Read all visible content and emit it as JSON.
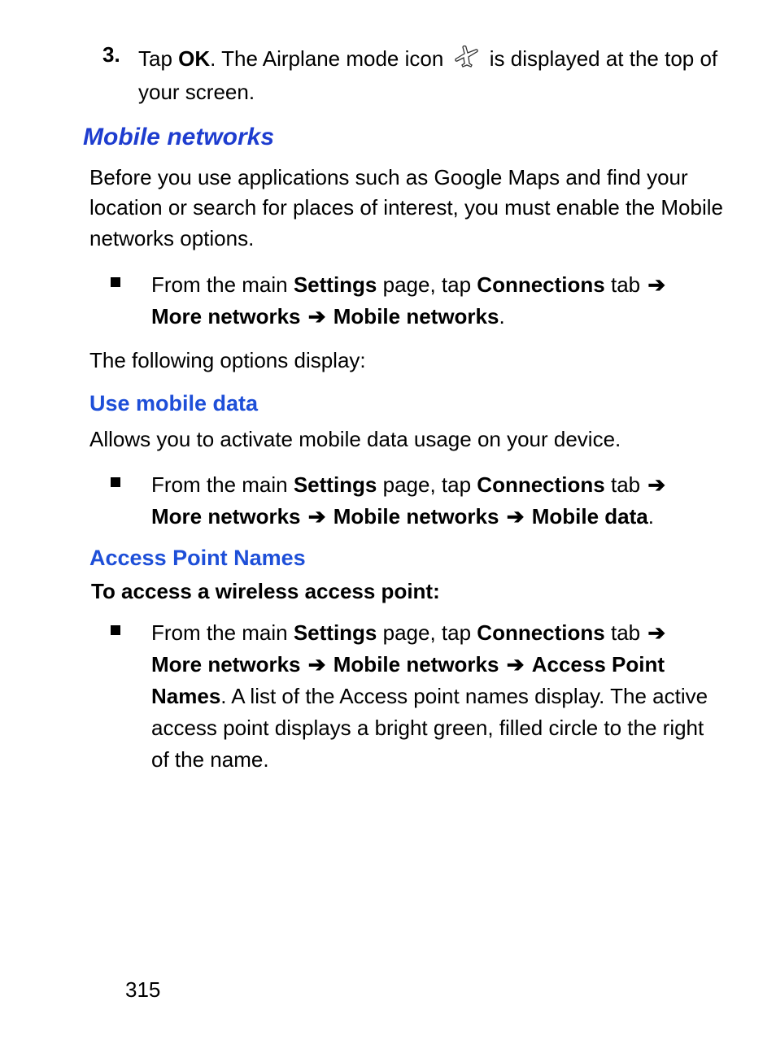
{
  "step3": {
    "num": "3.",
    "t1": "Tap ",
    "ok": "OK",
    "t2": ". The Airplane mode icon ",
    "t3": " is displayed at the top of your screen."
  },
  "h2_mobile_networks": "Mobile networks",
  "mobile_networks_intro": "Before you use applications such as Google Maps and find your location or search for places of interest, you must enable the Mobile networks options.",
  "nav1": {
    "t1": "From the main ",
    "settings": "Settings",
    "t2": " page, tap ",
    "connections": "Connections",
    "t3": " tab ",
    "arrow1": "➔",
    "more_networks": "More networks",
    "arrow2": "➔",
    "mobile_networks": "Mobile networks",
    "period": "."
  },
  "following_options": "The following options display:",
  "h3_use_mobile_data": "Use mobile data",
  "use_mobile_data_body": "Allows you to activate mobile data usage on your device.",
  "nav2": {
    "t1": "From the main ",
    "settings": "Settings",
    "t2": " page, tap ",
    "connections": "Connections",
    "t3": " tab ",
    "arrow1": "➔",
    "more_networks": "More networks",
    "arrow2": "➔",
    "mobile_networks": "Mobile networks",
    "arrow3": "➔",
    "mobile_data": "Mobile data",
    "period": "."
  },
  "h3_apn": "Access Point Names",
  "apn_lead": "To access a wireless access point:",
  "nav3": {
    "t1": "From the main ",
    "settings": "Settings",
    "t2": " page, tap ",
    "connections": "Connections",
    "t3": " tab ",
    "arrow1": "➔",
    "more_networks": "More networks",
    "arrow2": "➔",
    "mobile_networks": "Mobile networks",
    "arrow3": "➔",
    "apn": "Access Point Names",
    "tail": ". A list of the Access point names display. The active access point displays a bright green, filled circle to the right of the name."
  },
  "page_number": "315"
}
